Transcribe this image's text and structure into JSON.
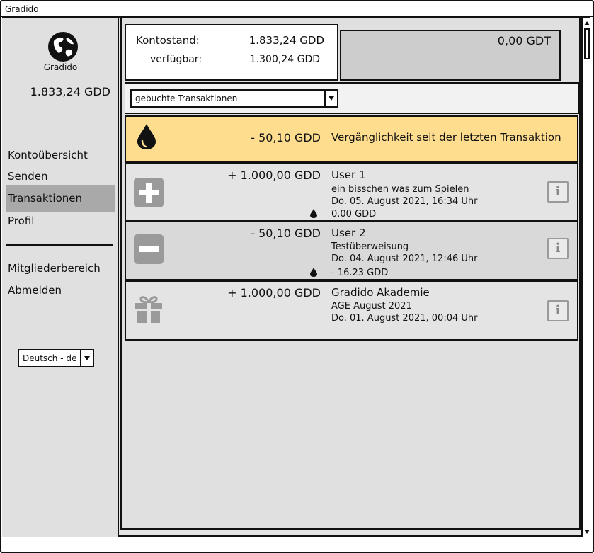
{
  "window": {
    "title": "Gradido"
  },
  "sidebar": {
    "logo_label": "Gradido",
    "balance": "1.833,24 GDD",
    "nav": [
      {
        "label": "Kontoübersicht",
        "active": false
      },
      {
        "label": "Senden",
        "active": false
      },
      {
        "label": "Transaktionen",
        "active": true
      },
      {
        "label": "Profil",
        "active": false
      }
    ],
    "nav_bottom": [
      {
        "label": "Mitgliederbereich"
      },
      {
        "label": "Abmelden"
      }
    ],
    "language": {
      "value": "Deutsch - de"
    }
  },
  "summary": {
    "balance_label": "Kontostand:",
    "balance_value": "1.833,24 GDD",
    "available_label": "verfügbar:",
    "available_value": "1.300,24 GDD",
    "gdt_value": "0,00 GDT"
  },
  "filter": {
    "value": "gebuchte Transaktionen"
  },
  "decay_row": {
    "amount": "- 50,10 GDD",
    "text": "Vergänglichkeit seit der letzten Transaktion"
  },
  "transactions": [
    {
      "icon": "plus-icon",
      "amount": "+ 1.000,00 GDD",
      "name": "User 1",
      "memo": "ein bisschen was zum Spielen",
      "date": "Do. 05. August 2021, 16:34 Uhr",
      "decay": "0.00 GDD"
    },
    {
      "icon": "minus-icon",
      "amount": "- 50,10 GDD",
      "name": "User 2",
      "memo": "Testüberweisung",
      "date": "Do. 04. August 2021, 12:46 Uhr",
      "decay": "- 16.23 GDD"
    },
    {
      "icon": "gift-icon",
      "amount": "+ 1.000,00 GDD",
      "name": "Gradido Akademie",
      "memo": "AGE August 2021",
      "date": "Do. 01. August 2021, 00:04 Uhr"
    }
  ],
  "colors": {
    "decay_background": "#ffdd8f",
    "nav_active": "#a9a9a9",
    "icon_gray": "#9a9a9a"
  }
}
